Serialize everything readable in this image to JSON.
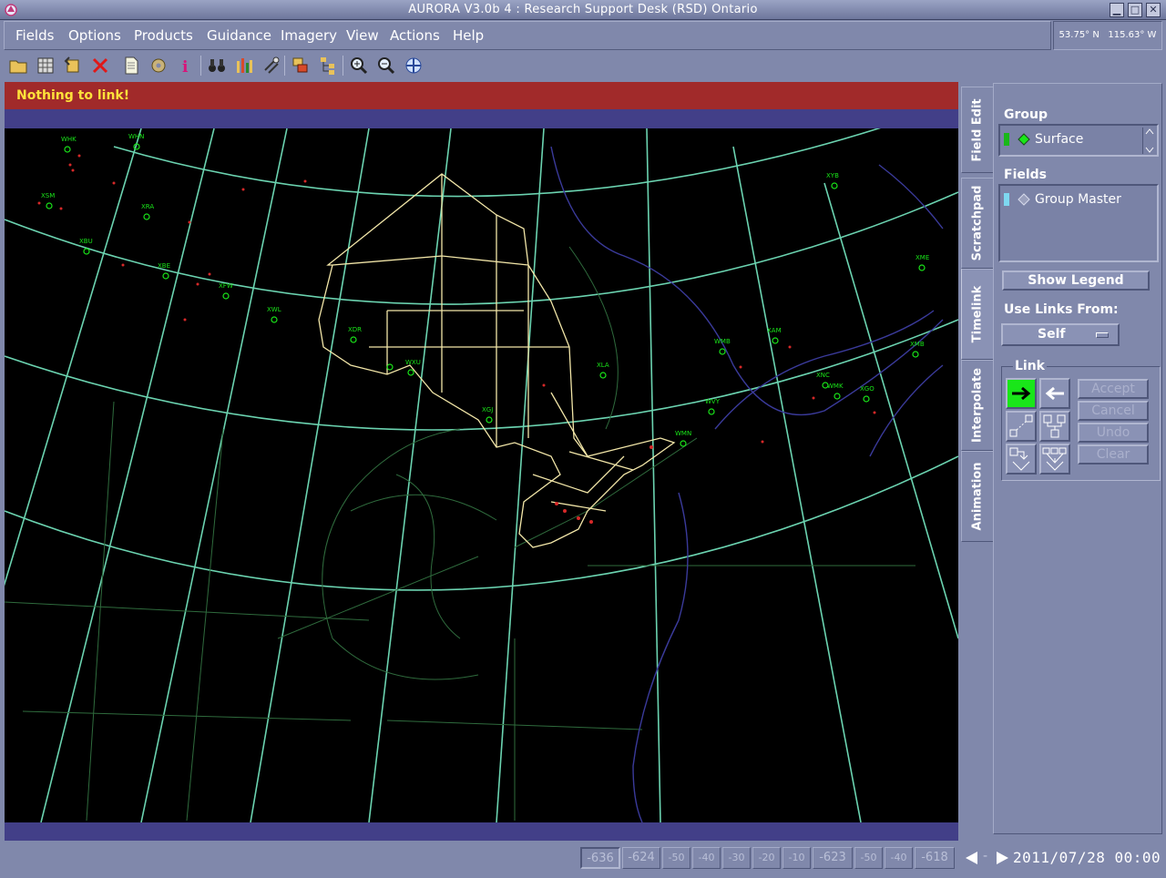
{
  "window": {
    "title": "AURORA V3.0b 4 : Research Support Desk (RSD) Ontario",
    "buttons": [
      "minimize",
      "maximize",
      "close"
    ]
  },
  "menubar": {
    "items": [
      "Fields",
      "Options",
      "Products",
      "Guidance",
      "Imagery",
      "View",
      "Actions",
      "Help"
    ]
  },
  "coordinates": {
    "lat": "53.75° N",
    "lon": "115.63° W"
  },
  "toolbar": {
    "tools": [
      "open-folder-icon",
      "save-grid-icon",
      "undo-icon",
      "delete-x-icon",
      "document-icon",
      "settings-gear-icon",
      "info-icon",
      "binoculars-icon",
      "bar-chart-icon",
      "satellite-dish-icon",
      "layers-icon",
      "tree-icon",
      "zoom-in-icon",
      "zoom-out-icon",
      "pan-icon"
    ]
  },
  "status": {
    "message": "Nothing to link!"
  },
  "map": {
    "stations": [
      "WHK",
      "WHN",
      "XSM",
      "XRA",
      "XBU",
      "XBE",
      "XFW",
      "XWL",
      "XDR",
      "WMB",
      "XAM",
      "XNC",
      "WMK",
      "XGO",
      "XMB",
      "XME",
      "XYB",
      "XLA",
      "WMN",
      "WVY",
      "XGJ",
      "WXU"
    ]
  },
  "tabs": [
    "Field Edit",
    "Scratchpad",
    "Timelink",
    "Interpolate",
    "Animation"
  ],
  "panel": {
    "group_label": "Group",
    "group_value": "Surface",
    "fields_label": "Fields",
    "fields_value": "Group Master",
    "show_legend": "Show Legend",
    "use_links_label": "Use Links From:",
    "use_links_value": "Self",
    "link_label": "Link",
    "accept": "Accept",
    "cancel": "Cancel",
    "undo": "Undo",
    "clear": "Clear"
  },
  "timeline": {
    "steps": [
      "-636",
      "-624",
      "-50",
      "-40",
      "-30",
      "-20",
      "-10",
      "-623",
      "-50",
      "-40",
      "-618"
    ],
    "date": "2011/07/28 00:00"
  }
}
